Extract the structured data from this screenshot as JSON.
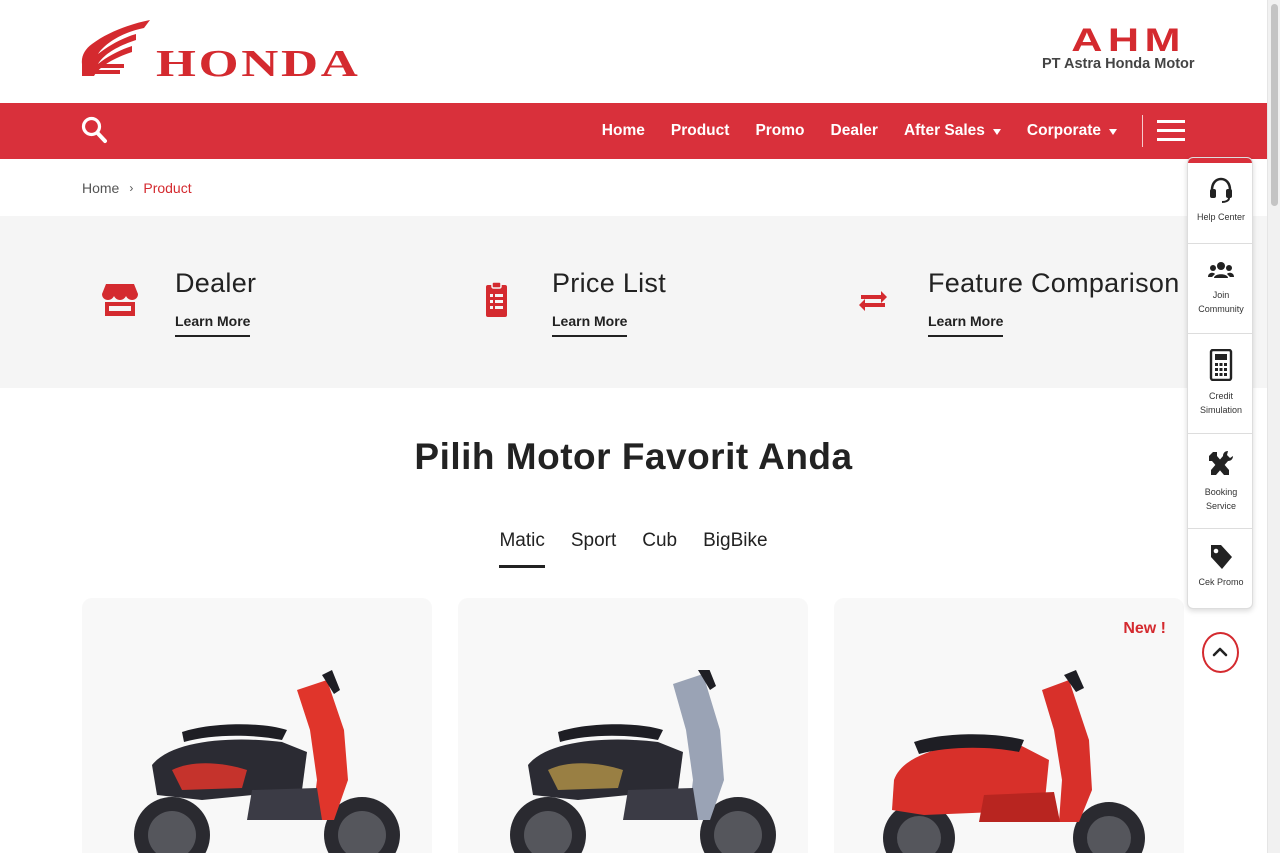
{
  "brand": {
    "left_logo": "HONDA",
    "right_logo": "AHM",
    "right_logo_sub": "PT Astra Honda Motor",
    "brand_color": "#d42a2f",
    "nav_color": "#d9303b"
  },
  "nav": {
    "search_icon": "search-icon",
    "items": [
      {
        "label": "Home"
      },
      {
        "label": "Product"
      },
      {
        "label": "Promo"
      },
      {
        "label": "Dealer"
      },
      {
        "label": "After Sales",
        "dropdown": true
      },
      {
        "label": "Corporate",
        "dropdown": true
      }
    ],
    "menu_icon": "hamburger-icon"
  },
  "breadcrumb": {
    "home": "Home",
    "separator": "›",
    "current": "Product"
  },
  "features": [
    {
      "title": "Dealer",
      "link": "Learn More",
      "icon": "store-icon"
    },
    {
      "title": "Price List",
      "link": "Learn More",
      "icon": "clipboard-list-icon"
    },
    {
      "title": "Feature Comparison",
      "link": "Learn More",
      "icon": "exchange-icon"
    }
  ],
  "section": {
    "title": "Pilih Motor Favorit Anda",
    "tabs": [
      {
        "label": "Matic",
        "active": true
      },
      {
        "label": "Sport",
        "active": false
      },
      {
        "label": "Cub",
        "active": false
      },
      {
        "label": "BigBike",
        "active": false
      }
    ]
  },
  "products": [
    {
      "badge": "",
      "colors": [
        "#e0352b",
        "#2b2b33"
      ]
    },
    {
      "badge": "",
      "colors": [
        "#9aa3b5",
        "#2b2b33"
      ]
    },
    {
      "badge": "New !",
      "colors": [
        "#d8302a",
        "#2b2b33"
      ]
    }
  ],
  "side_panel": [
    {
      "label": "Help Center",
      "icon": "headset-icon"
    },
    {
      "label": "Join Community",
      "icon": "users-icon"
    },
    {
      "label": "Credit Simulation",
      "icon": "calculator-icon"
    },
    {
      "label": "Booking Service",
      "icon": "tools-icon"
    },
    {
      "label": "Cek Promo",
      "icon": "tag-icon"
    }
  ],
  "scroll_top_icon": "chevron-up-icon"
}
